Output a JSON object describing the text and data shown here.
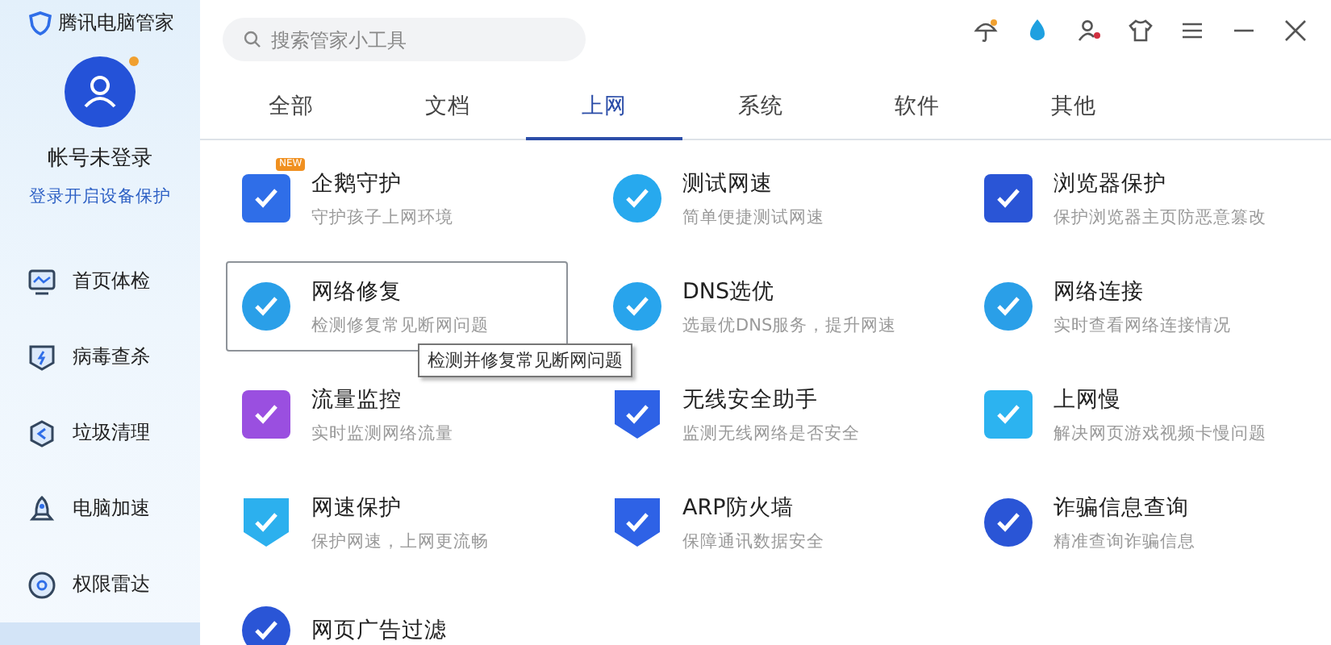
{
  "app": {
    "title": "腾讯电脑管家"
  },
  "account": {
    "name": "帐号未登录",
    "link": "登录开启设备保护",
    "notice": true
  },
  "sidebar": {
    "items": [
      {
        "label": "首页体检",
        "selected": false
      },
      {
        "label": "病毒查杀",
        "selected": false
      },
      {
        "label": "垃圾清理",
        "selected": false
      },
      {
        "label": "电脑加速",
        "selected": false
      },
      {
        "label": "权限雷达",
        "selected": false
      },
      {
        "selected": true
      }
    ]
  },
  "search": {
    "placeholder": "搜索管家小工具"
  },
  "tabs": [
    {
      "label": "全部",
      "selected": false
    },
    {
      "label": "文档",
      "selected": false
    },
    {
      "label": "上网",
      "selected": true
    },
    {
      "label": "系统",
      "selected": false
    },
    {
      "label": "软件",
      "selected": false
    },
    {
      "label": "其他",
      "selected": false
    }
  ],
  "tools": [
    {
      "title": "企鹅守护",
      "desc": "守护孩子上网环境",
      "kind": "square",
      "color": "#2f6ee8",
      "badge": "NEW",
      "hovered": false
    },
    {
      "title": "测试网速",
      "desc": "简单便捷测试网速",
      "kind": "circle",
      "color": "#27a9ee",
      "hovered": false
    },
    {
      "title": "浏览器保护",
      "desc": "保护浏览器主页防恶意篡改",
      "kind": "square",
      "color": "#2a55d6",
      "hovered": false
    },
    {
      "title": "网络修复",
      "desc": "检测修复常见断网问题",
      "kind": "circle",
      "color": "#2a9fe8",
      "hovered": true,
      "tooltip": "检测并修复常见断网问题"
    },
    {
      "title": "DNS选优",
      "desc": "选最优DNS服务，提升网速",
      "kind": "circle",
      "color": "#28a4ec",
      "hovered": false
    },
    {
      "title": "网络连接",
      "desc": "实时查看网络连接情况",
      "kind": "circle",
      "color": "#2a9fe8",
      "hovered": false
    },
    {
      "title": "流量监控",
      "desc": "实时监测网络流量",
      "kind": "square",
      "color": "#9a4fe0",
      "hovered": false
    },
    {
      "title": "无线安全助手",
      "desc": "监测无线网络是否安全",
      "kind": "shield",
      "color": "#2e62e6",
      "hovered": false
    },
    {
      "title": "上网慢",
      "desc": "解决网页游戏视频卡慢问题",
      "kind": "square",
      "color": "#2cb3f0",
      "hovered": false
    },
    {
      "title": "网速保护",
      "desc": "保护网速，上网更流畅",
      "kind": "shield",
      "color": "#2cb0ee",
      "hovered": false
    },
    {
      "title": "ARP防火墙",
      "desc": "保障通讯数据安全",
      "kind": "shield",
      "color": "#2e62e6",
      "hovered": false
    },
    {
      "title": "诈骗信息查询",
      "desc": "精准查询诈骗信息",
      "kind": "circle",
      "color": "#2a55d6",
      "hovered": false
    },
    {
      "title": "网页广告过滤",
      "kind": "circle",
      "color": "#2a55d6",
      "hovered": false
    }
  ]
}
